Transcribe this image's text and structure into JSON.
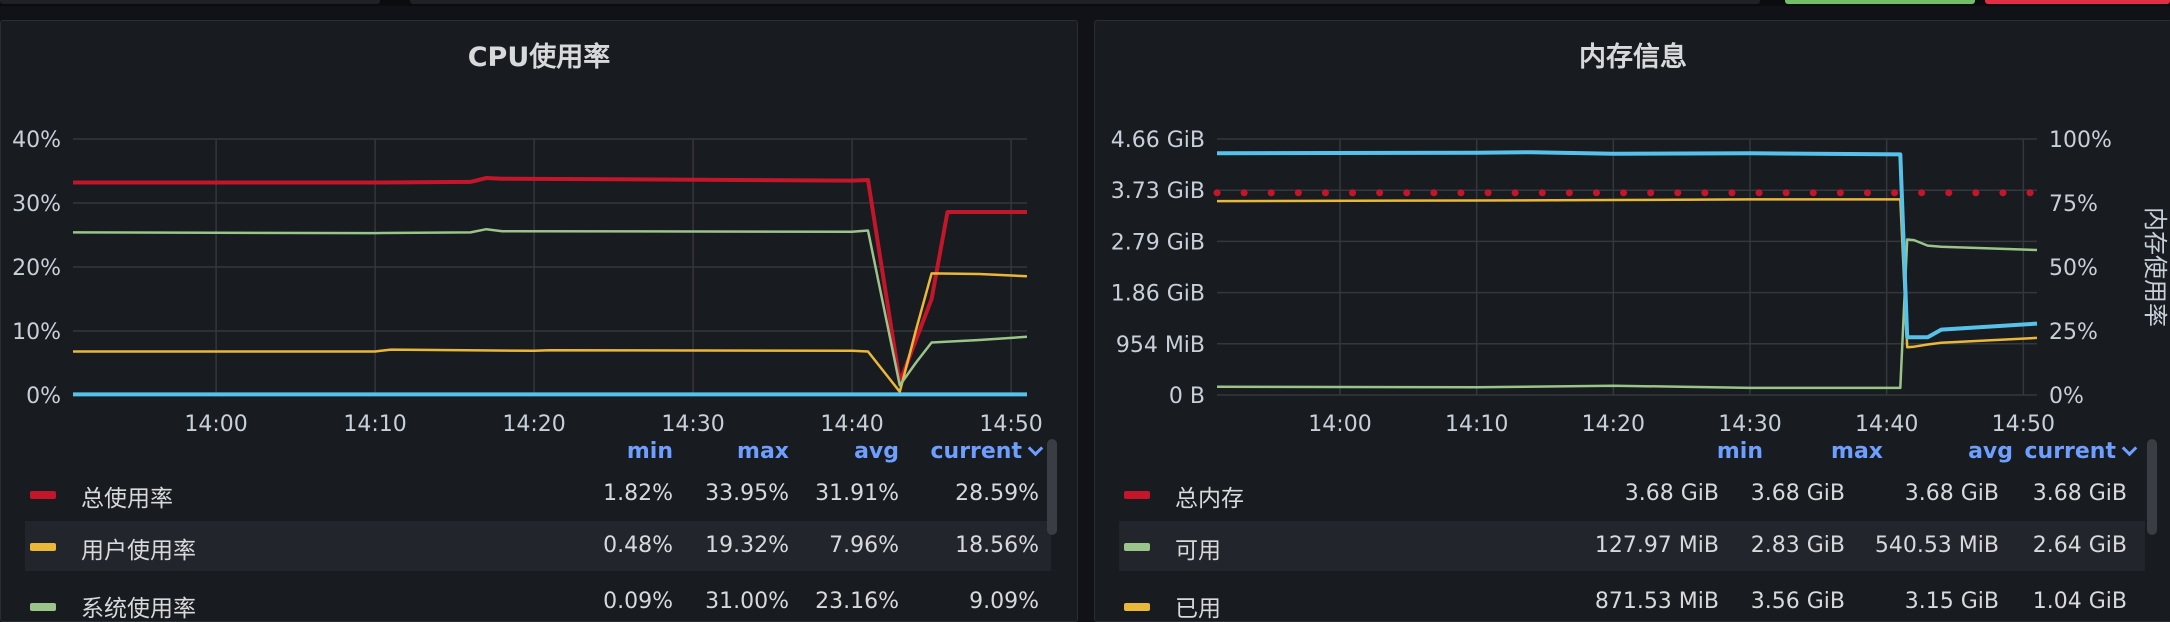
{
  "colors": {
    "red": "#c4162a",
    "yellow": "#eab839",
    "green": "#9ac48a",
    "blue": "#56c2ea",
    "header_link": "#6e9fff"
  },
  "cpu_panel": {
    "title": "CPU使用率",
    "legend_headers": [
      "min",
      "max",
      "avg",
      "current"
    ],
    "rows": [
      {
        "name": "总使用率",
        "min": "1.82%",
        "max": "33.95%",
        "avg": "31.91%",
        "current": "28.59%"
      },
      {
        "name": "用户使用率",
        "min": "0.48%",
        "max": "19.32%",
        "avg": "7.96%",
        "current": "18.56%"
      },
      {
        "name": "系统使用率",
        "min": "0.09%",
        "max": "31.00%",
        "avg": "23.16%",
        "current": "9.09%"
      }
    ]
  },
  "mem_panel": {
    "title": "内存信息",
    "right_axis_label": "内存使用率",
    "legend_headers": [
      "min",
      "max",
      "avg",
      "current"
    ],
    "rows": [
      {
        "name": "总内存",
        "min": "3.68 GiB",
        "max": "3.68 GiB",
        "avg": "3.68 GiB",
        "current": "3.68 GiB"
      },
      {
        "name": "可用",
        "min": "127.97 MiB",
        "max": "2.83 GiB",
        "avg": "540.53 MiB",
        "current": "2.64 GiB"
      },
      {
        "name": "已用",
        "min": "871.53 MiB",
        "max": "3.56 GiB",
        "avg": "3.15 GiB",
        "current": "1.04 GiB"
      }
    ]
  },
  "chart_data": [
    {
      "type": "line",
      "title": "CPU使用率",
      "x_tick_labels": [
        "14:00",
        "14:10",
        "14:20",
        "14:30",
        "14:40",
        "14:50"
      ],
      "y_tick_labels": [
        "0%",
        "10%",
        "20%",
        "30%",
        "40%"
      ],
      "xlim": [
        -9,
        51
      ],
      "ylim": [
        0,
        40
      ],
      "grid": true,
      "series": [
        {
          "name": "总使用率",
          "color": "#c4162a",
          "x": [
            -9,
            10,
            16,
            17,
            18,
            40,
            41,
            43,
            45,
            46,
            48,
            51
          ],
          "y": [
            33.2,
            33.2,
            33.3,
            33.9,
            33.8,
            33.5,
            33.6,
            2,
            15,
            28.6,
            28.6,
            28.59
          ]
        },
        {
          "name": "用户使用率",
          "color": "#eab839",
          "x": [
            -9,
            10,
            11,
            20,
            21,
            40,
            41,
            43,
            44,
            45,
            48,
            51
          ],
          "y": [
            6.8,
            6.8,
            7.1,
            6.9,
            7.0,
            6.9,
            6.8,
            0.5,
            10,
            19.0,
            18.9,
            18.56
          ]
        },
        {
          "name": "系统使用率",
          "color": "#9ac48a",
          "x": [
            -9,
            10,
            16,
            17,
            18,
            40,
            41,
            43,
            44,
            45,
            48,
            51
          ],
          "y": [
            25.4,
            25.3,
            25.4,
            25.9,
            25.6,
            25.5,
            25.7,
            1.5,
            5,
            8.2,
            8.6,
            9.09
          ]
        },
        {
          "name": "",
          "color": "#56c2ea",
          "x": [
            -9,
            51
          ],
          "y": [
            0.1,
            0.1
          ]
        }
      ]
    },
    {
      "type": "line",
      "title": "内存信息",
      "x_tick_labels": [
        "14:00",
        "14:10",
        "14:20",
        "14:30",
        "14:40",
        "14:50"
      ],
      "y_tick_labels_left": [
        "0 B",
        "954 MiB",
        "1.86 GiB",
        "2.79 GiB",
        "3.73 GiB",
        "4.66 GiB"
      ],
      "y_tick_labels_right": [
        "0%",
        "25%",
        "50%",
        "75%",
        "100%"
      ],
      "ylabel_right": "内存使用率",
      "xlim": [
        -9,
        51
      ],
      "ylim": [
        0,
        4.66
      ],
      "grid": true,
      "series": [
        {
          "name": "总内存",
          "color": "#c4162a",
          "style": "dotted",
          "x": [
            -9,
            51
          ],
          "y": [
            3.68,
            3.68
          ]
        },
        {
          "name": "可用",
          "color": "#9ac48a",
          "x": [
            -9,
            10,
            20,
            30,
            41,
            41.5,
            42,
            43,
            44,
            51
          ],
          "y": [
            0.15,
            0.14,
            0.17,
            0.13,
            0.13,
            2.83,
            2.82,
            2.72,
            2.7,
            2.64
          ]
        },
        {
          "name": "已用",
          "color": "#eab839",
          "x": [
            -9,
            10,
            20,
            30,
            41,
            41.5,
            42,
            43,
            44,
            51
          ],
          "y": [
            3.53,
            3.54,
            3.55,
            3.56,
            3.56,
            0.87,
            0.88,
            0.92,
            0.95,
            1.04
          ]
        },
        {
          "name": "",
          "color": "#56c2ea",
          "x": [
            -9,
            10,
            14,
            20,
            30,
            41,
            41.5,
            43,
            44,
            51
          ],
          "y": [
            4.4,
            4.41,
            4.42,
            4.39,
            4.4,
            4.38,
            1.05,
            1.05,
            1.19,
            1.3
          ]
        }
      ]
    }
  ]
}
